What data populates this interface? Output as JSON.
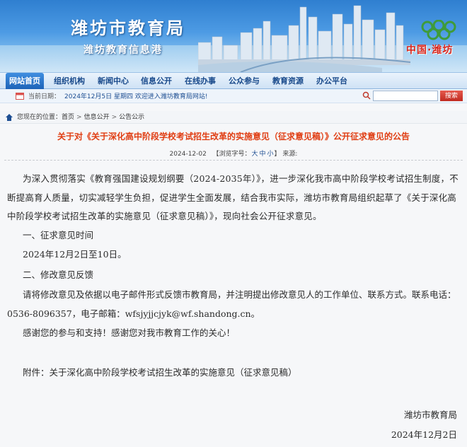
{
  "banner": {
    "title": "潍坊市教育局",
    "subtitle": "潍坊教育信息港",
    "logo_text": "中国·潍坊"
  },
  "nav": {
    "items": [
      {
        "label": "网站首页",
        "active": true
      },
      {
        "label": "组织机构"
      },
      {
        "label": "新闻中心"
      },
      {
        "label": "信息公开"
      },
      {
        "label": "在线办事"
      },
      {
        "label": "公众参与"
      },
      {
        "label": "教育资源"
      },
      {
        "label": "办公平台"
      }
    ]
  },
  "datebar": {
    "label": "当前日期：",
    "value": "2024年12月5日 星期四 欢迎进入潍坊教育局网站!",
    "search_placeholder": "",
    "search_button": "搜索"
  },
  "breadcrumb": {
    "prefix": "您现在的位置：",
    "items": [
      "首页",
      "信息公开",
      "公告公示"
    ],
    "sep": ">"
  },
  "article": {
    "title": "关于对《关于深化高中阶段学校考试招生改革的实施意见（征求意见稿）》公开征求意见的公告",
    "date": "2024-12-02",
    "font_label_open": "【浏览字号：",
    "font_sizes": [
      "大",
      "中",
      "小"
    ],
    "font_label_close": "】",
    "source_label": "来源:",
    "intro": "为深入贯彻落实《教育强国建设规划纲要（2024-2035年）》，进一步深化我市高中阶段学校考试招生制度，不断提高育人质量，切实减轻学生负担，促进学生全面发展，结合我市实际，潍坊市教育局组织起草了《关于深化高中阶段学校考试招生改革的实施意见（征求意见稿）》，现向社会公开征求意见。",
    "section1": "一、征求意见时间",
    "section1_detail": "2024年12月2日至10日。",
    "section2": "二、修改意见反馈",
    "contact": "请将修改意见及依据以电子邮件形式反馈市教育局，并注明提出修改意见人的工作单位、联系方式。联系电话：0536-8096357，电子邮箱：wfsjyjjcjyk@wf.shandong.cn。",
    "thanks": "感谢您的参与和支持！感谢您对我市教育工作的关心！",
    "attachment": "附件：关于深化高中阶段学校考试招生改革的实施意见（征求意见稿）",
    "signature": "潍坊市教育局",
    "sign_date": "2024年12月2日"
  },
  "colors": {
    "title_red": "#e03d12",
    "nav_blue": "#17488a",
    "active_blue": "#1e63b8",
    "search_red": "#c02a20"
  }
}
